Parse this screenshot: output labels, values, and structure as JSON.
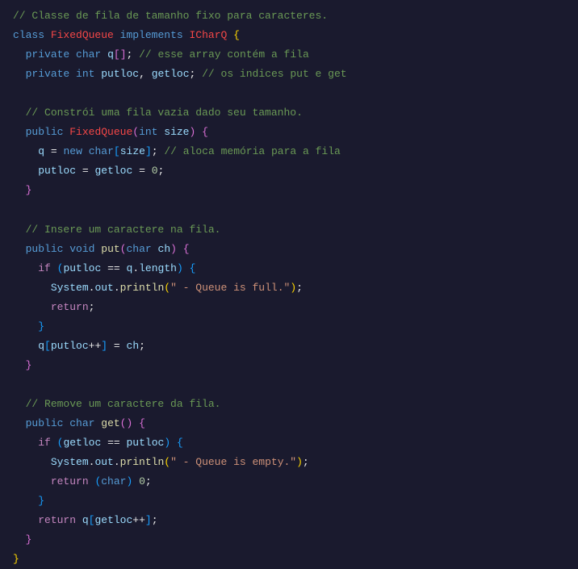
{
  "code": {
    "c1": "// Classe de fila de tamanho fixo para caracteres.",
    "class": "class",
    "FixedQueue": "FixedQueue",
    "implements": "implements",
    "ICharQ": "ICharQ",
    "private": "private",
    "char": "char",
    "q": "q",
    "c2": "// esse array contém a fila",
    "int": "int",
    "putloc": "putloc",
    "getloc": "getloc",
    "c3": "// os indices put e get",
    "c4": "// Constrói uma fila vazia dado seu tamanho.",
    "public": "public",
    "size": "size",
    "new": "new",
    "c5": "// aloca memória para a fila",
    "zero": "0",
    "c6": "// Insere um caractere na fila.",
    "void": "void",
    "put": "put",
    "ch": "ch",
    "if": "if",
    "length": "length",
    "System": "System",
    "out": "out",
    "println": "println",
    "s1": "\" - Queue is full.\"",
    "return": "return",
    "c7": "// Remove um caractere da fila.",
    "get": "get",
    "s2": "\" - Queue is empty.\"",
    "eq": "=",
    "eqeq": "==",
    "pp": "++",
    "semi": ";",
    "comma": ",",
    "dot": ".",
    "lbrace": "{",
    "rbrace": "}",
    "lparen": "(",
    "rparen": ")",
    "lbrack": "[",
    "rbrack": "]"
  }
}
